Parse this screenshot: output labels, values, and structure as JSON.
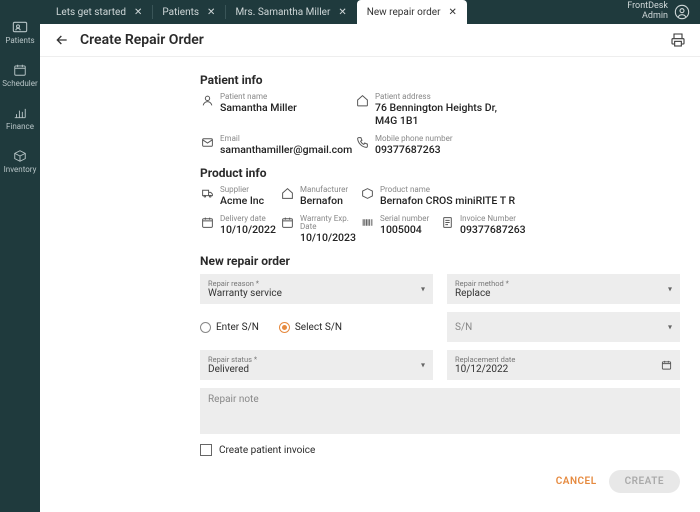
{
  "user": {
    "name": "FrontDesk",
    "role": "Admin"
  },
  "tabs": [
    {
      "label": "Lets get started"
    },
    {
      "label": "Patients"
    },
    {
      "label": "Mrs. Samantha Miller"
    },
    {
      "label": "New repair order"
    }
  ],
  "sidebar": {
    "items": [
      {
        "label": "Patients"
      },
      {
        "label": "Scheduler"
      },
      {
        "label": "Finance"
      },
      {
        "label": "Inventory"
      }
    ]
  },
  "page": {
    "title": "Create Repair Order"
  },
  "patient_info": {
    "title": "Patient info",
    "name_label": "Patient name",
    "name": "Samantha Miller",
    "address_label": "Patient address",
    "address": "76 Bennington Heights Dr, M4G 1B1",
    "email_label": "Email",
    "email": "samanthamiller@gmail.com",
    "phone_label": "Mobile phone number",
    "phone": "09377687263"
  },
  "product_info": {
    "title": "Product info",
    "supplier_label": "Supplier",
    "supplier": "Acme Inc",
    "manufacturer_label": "Manufacturer",
    "manufacturer": "Bernafon",
    "product_label": "Product name",
    "product": "Bernafon CROS miniRITE T R",
    "delivery_label": "Delivery date",
    "delivery": "10/10/2022",
    "warranty_exp_label": "Warranty Exp. Date",
    "warranty_exp": "10/10/2023",
    "serial_label": "Serial number",
    "serial": "1005004",
    "invoice_label": "Invoice Number",
    "invoice": "09377687263"
  },
  "repair_order": {
    "title": "New repair order",
    "reason_label": "Repair reason *",
    "reason": "Warranty service",
    "method_label": "Repair method *",
    "method": "Replace",
    "enter_sn": "Enter S/N",
    "select_sn": "Select S/N",
    "sn_placeholder": "S/N",
    "status_label": "Repair status *",
    "status": "Delivered",
    "replacement_label": "Replacement date",
    "replacement": "10/12/2022",
    "note_placeholder": "Repair note",
    "create_invoice_label": "Create patient invoice",
    "cancel_label": "CANCEL",
    "create_label": "CREATE"
  }
}
